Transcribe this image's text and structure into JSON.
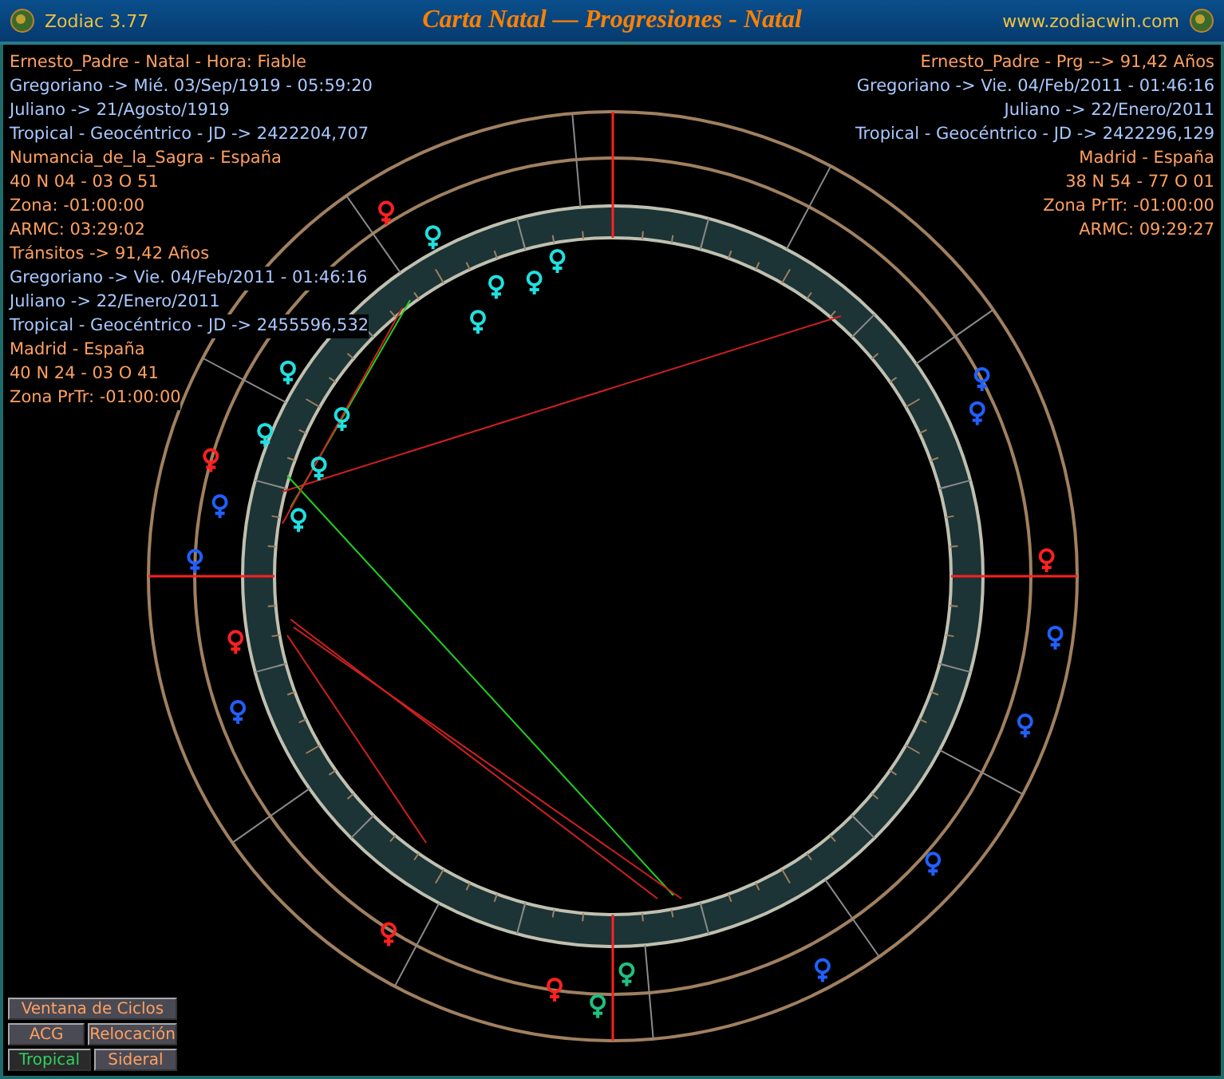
{
  "window": {
    "app_name": "Zodiac 3.77",
    "title": "Carta Natal — Progresiones - Natal",
    "website": "www.zodiacwin.com"
  },
  "natal_info": [
    {
      "text": "Ernesto_Padre - Natal - Hora: Fiable",
      "kind": "place"
    },
    {
      "text": "Gregoriano -> Mié. 03/Sep/1919 - 05:59:20",
      "kind": "date"
    },
    {
      "text": "Juliano -> 21/Agosto/1919",
      "kind": "date"
    },
    {
      "text": "Tropical - Geocéntrico - JD -> 2422204,707",
      "kind": "date"
    },
    {
      "text": "Numancia_de_la_Sagra - España",
      "kind": "place"
    },
    {
      "text": "40 N 04 - 03 O 51",
      "kind": "place"
    },
    {
      "text": "Zona: -01:00:00",
      "kind": "place"
    },
    {
      "text": "ARMC: 03:29:02",
      "kind": "place"
    },
    {
      "text": "Tránsitos -> 91,42 Años",
      "kind": "place"
    },
    {
      "text": "Gregoriano -> Vie. 04/Feb/2011 - 01:46:16",
      "kind": "date"
    },
    {
      "text": "Juliano -> 22/Enero/2011",
      "kind": "date"
    },
    {
      "text": "Tropical - Geocéntrico - JD -> 2455596,532",
      "kind": "date"
    },
    {
      "text": "Madrid - España",
      "kind": "place"
    },
    {
      "text": "40 N 24 - 03 O 41",
      "kind": "place"
    },
    {
      "text": "Zona PrTr: -01:00:00",
      "kind": "place"
    }
  ],
  "progressed_info": [
    {
      "text": "Ernesto_Padre - Prg --> 91,42 Años",
      "kind": "place"
    },
    {
      "text": "Gregoriano -> Vie. 04/Feb/2011 - 01:46:16",
      "kind": "date"
    },
    {
      "text": "Juliano -> 22/Enero/2011",
      "kind": "date"
    },
    {
      "text": "Tropical - Geocéntrico - JD -> 2422296,129",
      "kind": "date"
    },
    {
      "text": "Madrid - España",
      "kind": "place"
    },
    {
      "text": "38 N 54 - 77 O 01",
      "kind": "place"
    },
    {
      "text": "Zona PrTr: -01:00:00",
      "kind": "place"
    },
    {
      "text": "ARMC: 09:29:27",
      "kind": "place"
    }
  ],
  "buttons": [
    [
      {
        "label": "Ventana de Ciclos",
        "selected": false
      }
    ],
    [
      {
        "label": "ACG",
        "selected": false
      },
      {
        "label": "Relocación",
        "selected": false
      }
    ],
    [
      {
        "label": "Tropical",
        "selected": true
      },
      {
        "label": "Sideral",
        "selected": false
      }
    ]
  ]
}
